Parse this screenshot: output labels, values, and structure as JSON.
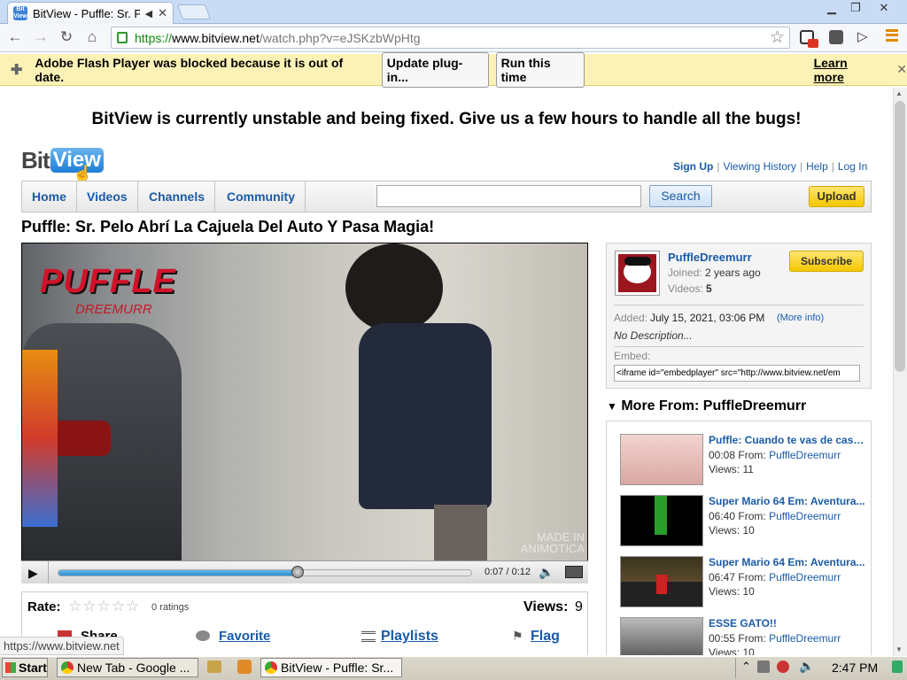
{
  "browser": {
    "tab_title": "BitView - Puffle: Sr. Pe",
    "favicon_text": "Bit View",
    "url_https": "https://",
    "url_host": "www.bitview.net",
    "url_path": "/watch.php?v=eJSKzbWpHtg",
    "flash_message": "Adobe Flash Player was blocked because it is out of date.",
    "update_btn": "Update plug-in...",
    "run_btn": "Run this time",
    "learn_more": "Learn more",
    "status_url": "https://www.bitview.net"
  },
  "announcement": "BitView is currently unstable and being fixed. Give us a few hours to handle all the bugs!",
  "logo": {
    "bit": "Bit",
    "view": "View"
  },
  "toplinks": {
    "signup": "Sign Up",
    "history": "Viewing History",
    "help": "Help",
    "login": "Log In"
  },
  "nav": {
    "home": "Home",
    "videos": "Videos",
    "channels": "Channels",
    "community": "Community",
    "search_btn": "Search",
    "upload_btn": "Upload",
    "search_value": ""
  },
  "video": {
    "title": "Puffle: Sr. Pelo Abrí La Cajuela Del Auto Y Pasa Magia!",
    "watermark_top": "PUFFLE",
    "watermark_sub": "DREEMURR",
    "watermark_br": "MADE IN ANIMOTICA",
    "time": "0:07 / 0:12",
    "progress": 0.58
  },
  "rating": {
    "label": "Rate:",
    "stars": 5,
    "ratings_text": "0 ratings",
    "views_label": "Views:",
    "views": "9",
    "share": "Share",
    "favorite": "Favorite",
    "playlists": "Playlists",
    "flag": "Flag"
  },
  "channel": {
    "name": "PuffleDreemurr",
    "joined_label": "Joined:",
    "joined": "2 years ago",
    "videos_label": "Videos:",
    "videos": "5",
    "subscribe": "Subscribe",
    "added_label": "Added:",
    "added": "July 15, 2021, 03:06 PM",
    "more_info": "(More info)",
    "description": "No Description...",
    "embed_label": "Embed:",
    "embed_code": "<iframe id=\"embedplayer\" src=\"http://www.bitview.net/em"
  },
  "more_from": {
    "heading": "More From: PuffleDreemurr",
    "items": [
      {
        "title": "Puffle: Cuando te vas de casa...",
        "duration": "00:08",
        "from_label": "From:",
        "author": "PuffleDreemurr",
        "views_label": "Views:",
        "views": "11"
      },
      {
        "title": "Super Mario 64 Em: Aventura...",
        "duration": "06:40",
        "from_label": "From:",
        "author": "PuffleDreemurr",
        "views_label": "Views:",
        "views": "10"
      },
      {
        "title": "Super Mario 64 Em: Aventura...",
        "duration": "06:47",
        "from_label": "From:",
        "author": "PuffleDreemurr",
        "views_label": "Views:",
        "views": "10"
      },
      {
        "title": "ESSE GATO!!",
        "duration": "00:55",
        "from_label": "From:",
        "author": "PuffleDreemurr",
        "views_label": "Views:",
        "views": "10"
      }
    ]
  },
  "taskbar": {
    "start": "Start",
    "task1": "New Tab - Google ...",
    "task2": "BitView - Puffle: Sr...",
    "clock": "2:47 PM"
  }
}
